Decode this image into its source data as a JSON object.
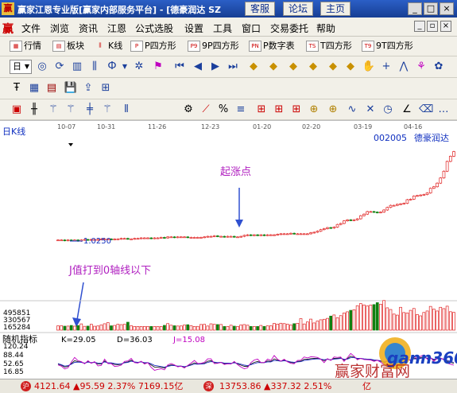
{
  "titlebar": {
    "logo": "赢",
    "title": "赢家江恩专业版[赢家内部服务平台] - [德豪润达 SZ",
    "links": [
      "客服",
      "论坛",
      "主页"
    ]
  },
  "menubar": {
    "logo": "赢",
    "items": [
      "文件",
      "浏览",
      "资讯",
      "江恩",
      "公式选股",
      "设置",
      "工具",
      "窗口",
      "交易委托",
      "帮助"
    ]
  },
  "toolbar1": {
    "items": [
      {
        "label": "行情",
        "icon": "quote-icon"
      },
      {
        "label": "板块",
        "icon": "sector-icon"
      },
      {
        "label": "K线",
        "icon": "kline-icon"
      },
      {
        "label": "P四方形",
        "icon": "P"
      },
      {
        "label": "9P四方形",
        "icon": "P9"
      },
      {
        "label": "P数字表",
        "icon": "PN"
      },
      {
        "label": "T四方形",
        "icon": "TS"
      },
      {
        "label": "9T四方形",
        "icon": "T9"
      }
    ]
  },
  "toolbar2": {
    "period_selector": "日"
  },
  "chart": {
    "panel_label": "日K线",
    "stock_code": "002005",
    "stock_name": "德豪润达",
    "date_labels": [
      "10-07",
      "10-31",
      "11-26",
      "12-23",
      "01-20",
      "02-20",
      "03-19",
      "04-16"
    ],
    "price_marker": "1.0250",
    "annotation_rise": "起涨点",
    "annotation_j": "J值打到0轴线以下",
    "volume_ticks": [
      "495851",
      "330567",
      "165284"
    ],
    "indicator_title": "随机指标",
    "kdj_values": {
      "K": "K=29.05",
      "D": "D=36.03",
      "J": "J=15.08"
    },
    "kdj_ticks": [
      "120.24",
      "88.44",
      "52.65",
      "16.85"
    ],
    "watermark_brand": "gann360",
    "watermark_text": "赢家财富网",
    "colors": {
      "up": "#e02020",
      "down": "#108010",
      "annotation": "#b020c0",
      "code": "#1030c0"
    }
  },
  "chart_data": {
    "type": "candlestick",
    "title": "日K线",
    "x_labels": [
      "10-07",
      "10-31",
      "11-26",
      "12-23",
      "01-20",
      "02-20",
      "03-19",
      "04-16"
    ],
    "closes": [
      1.02,
      1.02,
      1.01,
      1.02,
      1.01,
      1.02,
      1.0,
      1.02,
      1.03,
      1.02,
      1.03,
      1.03,
      1.03,
      1.04,
      1.04,
      1.04,
      1.03,
      1.04,
      1.04,
      1.05,
      1.05,
      1.04,
      1.04,
      1.05,
      1.05,
      1.06,
      1.06,
      1.06,
      1.05,
      1.06,
      1.06,
      1.07,
      1.06,
      1.08,
      1.08,
      1.07,
      1.08,
      1.08,
      1.08,
      1.07,
      1.07,
      1.07,
      1.07,
      1.07,
      1.08,
      1.09,
      1.09,
      1.1,
      1.09,
      1.09,
      1.08,
      1.09,
      1.09,
      1.08,
      1.08,
      1.09,
      1.11,
      1.12,
      1.11,
      1.12,
      1.11,
      1.12,
      1.11,
      1.12,
      1.12,
      1.12,
      1.13,
      1.14,
      1.14,
      1.14,
      1.15,
      1.14,
      1.14,
      1.14,
      1.14,
      1.14,
      1.16,
      1.17,
      1.19,
      1.22,
      1.24,
      1.26,
      1.25,
      1.27,
      1.32,
      1.34,
      1.39,
      1.41,
      1.4,
      1.41,
      1.43,
      1.49,
      1.52,
      1.57,
      1.57,
      1.56,
      1.55,
      1.56,
      1.6,
      1.65,
      1.69,
      1.69,
      1.71,
      1.72,
      1.73,
      1.8,
      1.81,
      1.87,
      1.88,
      1.89,
      1.9,
      1.93,
      2.02,
      2.05,
      2.12,
      2.22,
      2.35,
      2.54,
      2.64,
      2.73
    ],
    "volumes": [
      58,
      60,
      54,
      55,
      64,
      54,
      63,
      85,
      52,
      55,
      80,
      53,
      57,
      70,
      87,
      102,
      59,
      64,
      80,
      75,
      80,
      108,
      60,
      50,
      50,
      50,
      50,
      50,
      50,
      50,
      50,
      50,
      65,
      89,
      67,
      60,
      56,
      57,
      70,
      74,
      62,
      50,
      51,
      77,
      79,
      56,
      86,
      79,
      76,
      77,
      50,
      50,
      67,
      54,
      50,
      70,
      76,
      67,
      50,
      50,
      50,
      64,
      51,
      58,
      60,
      92,
      82,
      94,
      89,
      81,
      70,
      88,
      93,
      156,
      84,
      111,
      150,
      98,
      123,
      141,
      148,
      160,
      191,
      206,
      168,
      197,
      233,
      249,
      269,
      277,
      332,
      360,
      342,
      328,
      341,
      347,
      373,
      352,
      402,
      303,
      280,
      218,
      204,
      310,
      239,
      233,
      269,
      294,
      212,
      194,
      240,
      260,
      322,
      285,
      260,
      310,
      292,
      325,
      250,
      241
    ],
    "kdj": {
      "K": [
        47,
        42,
        34,
        37,
        49,
        61,
        57,
        55,
        50,
        57,
        52,
        55,
        47,
        47,
        60,
        51,
        51,
        45,
        44,
        46,
        54,
        56,
        63,
        55,
        53,
        57,
        51,
        53,
        43,
        34,
        34,
        33,
        30,
        39,
        43,
        41,
        37,
        38,
        34,
        39,
        45,
        52,
        47,
        48,
        50,
        59,
        61,
        53,
        52,
        54,
        49,
        50,
        49,
        54,
        48,
        42,
        37,
        37,
        47,
        54,
        58,
        53,
        53,
        60,
        58,
        69,
        63,
        59,
        63,
        58,
        54,
        52,
        58,
        59,
        67,
        67,
        70,
        71,
        71,
        68,
        61,
        68,
        64,
        71,
        71,
        73,
        64,
        70,
        80,
        76,
        69,
        71,
        68,
        67,
        66,
        62,
        63,
        59,
        53,
        60,
        61,
        60,
        62,
        59,
        66,
        67,
        63,
        73,
        68,
        74,
        78,
        71,
        73,
        64,
        70,
        71,
        67,
        59,
        54,
        50
      ],
      "D": [
        49,
        44,
        38,
        40,
        46,
        54,
        55,
        54,
        51,
        55,
        53,
        54,
        51,
        50,
        56,
        52,
        52,
        49,
        47,
        48,
        52,
        54,
        59,
        56,
        54,
        56,
        53,
        53,
        48,
        41,
        39,
        36,
        34,
        37,
        40,
        40,
        38,
        38,
        36,
        38,
        42,
        47,
        46,
        47,
        48,
        54,
        57,
        55,
        53,
        54,
        51,
        51,
        50,
        52,
        50,
        46,
        42,
        40,
        44,
        49,
        53,
        53,
        53,
        56,
        56,
        62,
        61,
        59,
        61,
        59,
        56,
        54,
        56,
        57,
        62,
        64,
        66,
        68,
        69,
        68,
        65,
        67,
        65,
        68,
        69,
        71,
        67,
        68,
        74,
        74,
        71,
        71,
        69,
        68,
        67,
        64,
        63,
        61,
        57,
        58,
        59,
        60,
        61,
        60,
        63,
        65,
        64,
        69,
        68,
        71,
        74,
        72,
        72,
        67,
        69,
        70,
        68,
        63,
        58,
        54
      ],
      "J": [
        43,
        38,
        26,
        31,
        55,
        75,
        61,
        57,
        48,
        61,
        50,
        57,
        39,
        41,
        68,
        49,
        49,
        37,
        38,
        42,
        58,
        60,
        71,
        53,
        51,
        59,
        47,
        53,
        33,
        20,
        24,
        27,
        22,
        43,
        49,
        43,
        35,
        38,
        30,
        41,
        51,
        62,
        49,
        50,
        54,
        69,
        69,
        49,
        50,
        54,
        45,
        48,
        47,
        58,
        44,
        34,
        27,
        31,
        53,
        64,
        68,
        53,
        53,
        68,
        62,
        83,
        67,
        59,
        67,
        56,
        50,
        48,
        62,
        63,
        77,
        73,
        78,
        77,
        75,
        68,
        53,
        70,
        62,
        77,
        75,
        77,
        58,
        74,
        92,
        80,
        65,
        71,
        66,
        65,
        64,
        58,
        63,
        55,
        45,
        64,
        65,
        60,
        64,
        57,
        72,
        71,
        61,
        81,
        68,
        80,
        86,
        67,
        75,
        58,
        72,
        73,
        65,
        51,
        46,
        42
      ]
    }
  },
  "statusbar": {
    "sh_icon": "沪",
    "sh_quote": "4121.64 ▲95.59 2.37% 7169.15亿",
    "sz_icon": "深",
    "sz_quote": "13753.86 ▲337.32 2.51%",
    "sz_tail": "亿"
  }
}
